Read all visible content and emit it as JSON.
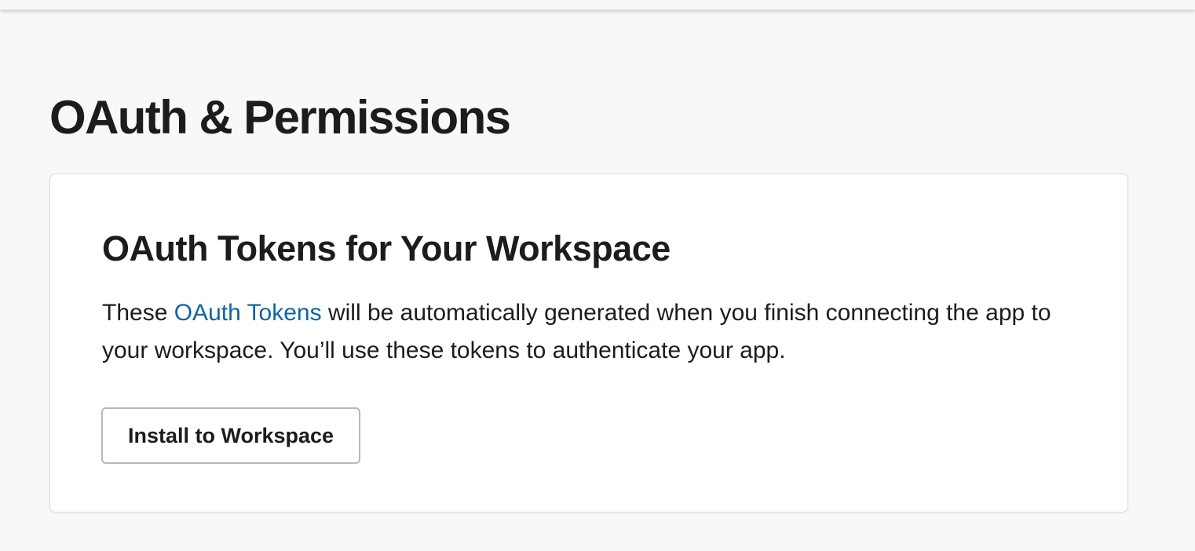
{
  "page": {
    "title": "OAuth & Permissions"
  },
  "card": {
    "title": "OAuth Tokens for Your Workspace",
    "description": {
      "before_link": "These ",
      "link_text": "OAuth Tokens",
      "after_link": " will be automatically generated when you finish connecting the app to your workspace. You’ll use these tokens to authenticate your app."
    },
    "install_button_label": "Install to Workspace"
  },
  "colors": {
    "background": "#f8f8f8",
    "text": "#1d1c1d",
    "link": "#1264a3",
    "card_bg": "#ffffff",
    "button_border": "#b8b8b8"
  }
}
